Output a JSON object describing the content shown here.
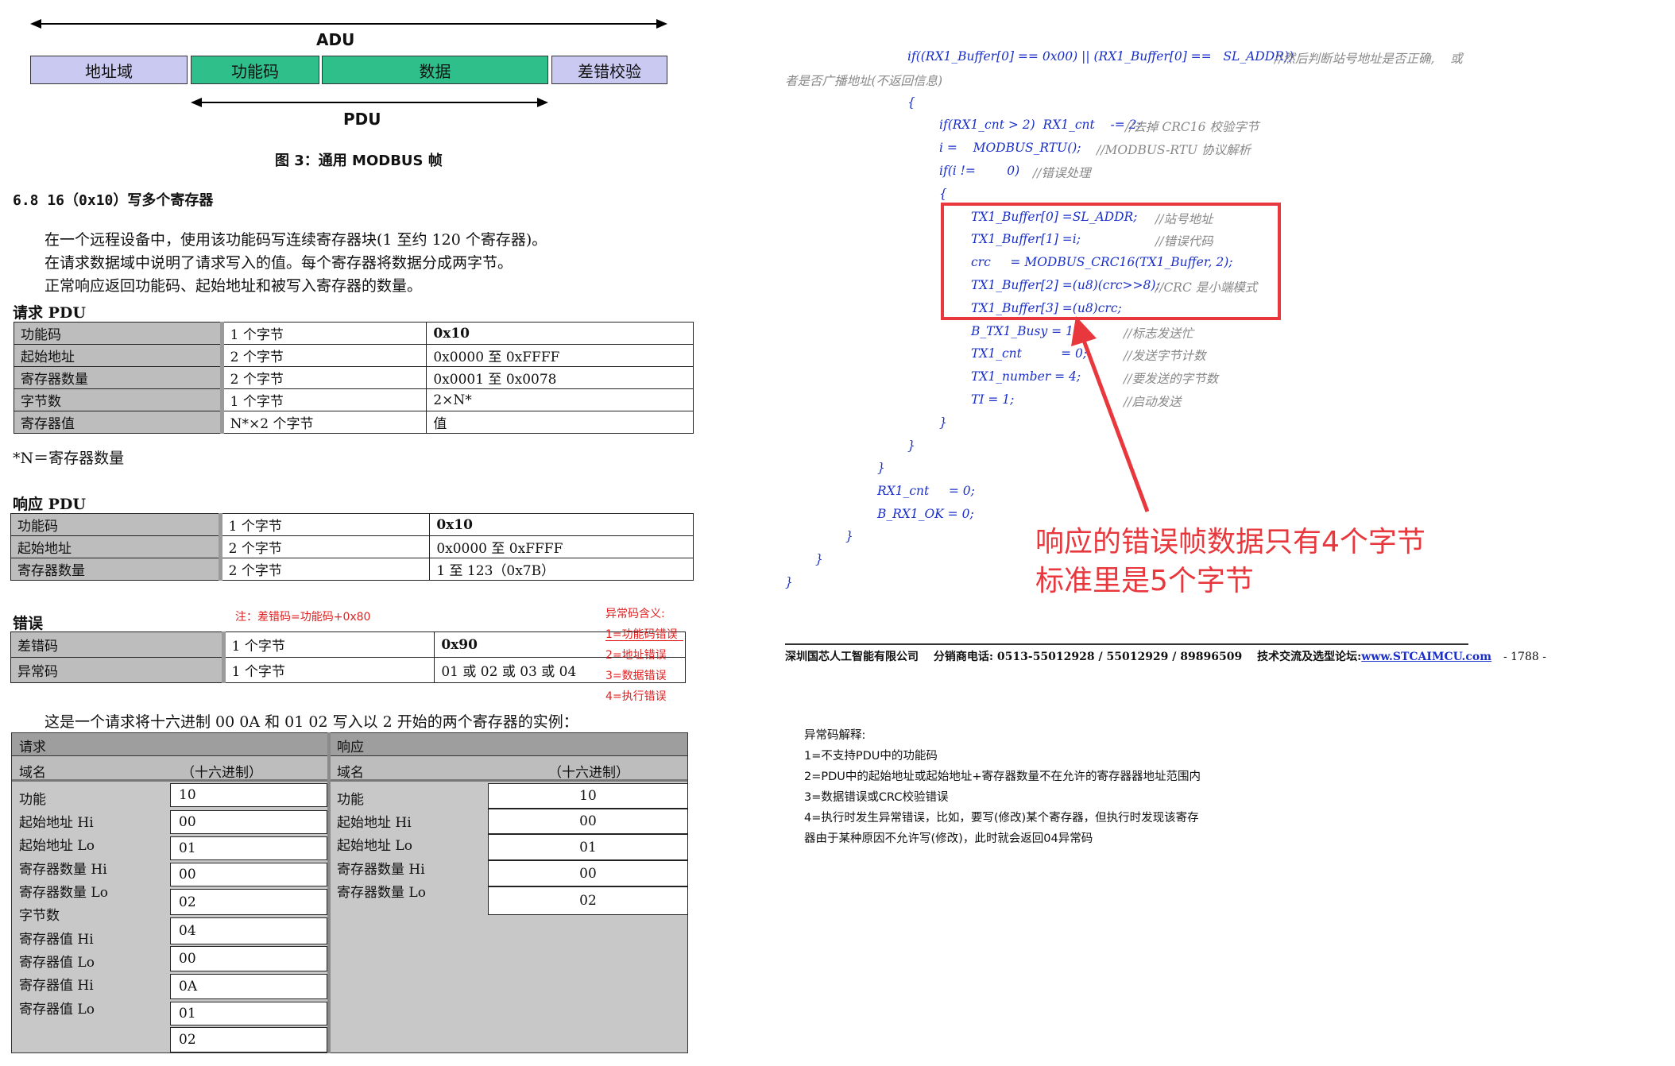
{
  "diagram": {
    "adu_label": "ADU",
    "pdu_label": "PDU",
    "boxes": [
      "地址域",
      "功能码",
      "数据",
      "差错校验"
    ],
    "caption": "图 3：通用 MODBUS 帧"
  },
  "section": {
    "title": "6.8   16（0x10）写多个寄存器",
    "para1": "在一个远程设备中，使用该功能码写连续寄存器块(1 至约 120 个寄存器)。",
    "para2": "在请求数据域中说明了请求写入的值。每个寄存器将数据分成两字节。",
    "para3": "正常响应返回功能码、起始地址和被写入寄存器的数量。"
  },
  "request_pdu": {
    "title": "请求 PDU",
    "rows": [
      [
        "功能码",
        "1 个字节",
        "0x10"
      ],
      [
        "起始地址",
        "2 个字节",
        "0x0000 至 0xFFFF"
      ],
      [
        "寄存器数量",
        "2 个字节",
        "0x0001 至 0x0078"
      ],
      [
        "字节数",
        "1 个字节",
        "2×N*"
      ],
      [
        "寄存器值",
        "N*×2 个字节",
        "值"
      ]
    ],
    "footnote": "*N＝寄存器数量"
  },
  "response_pdu": {
    "title": "响应 PDU",
    "rows": [
      [
        "功能码",
        "1 个字节",
        "0x10"
      ],
      [
        "起始地址",
        "2 个字节",
        "0x0000 至 0xFFFF"
      ],
      [
        "寄存器数量",
        "2 个字节",
        "1 至 123（0x7B）"
      ]
    ]
  },
  "error_pdu": {
    "title": "错误",
    "note": "注：差错码=功能码+0x80",
    "rows": [
      [
        "差错码",
        "1 个字节",
        "0x90"
      ],
      [
        "异常码",
        "1 个字节",
        "01 或 02 或 03 或 04"
      ]
    ],
    "exception_title": "异常码含义:",
    "exception_items": [
      "1=功能码错误",
      "2=地址错误",
      "3=数据错误",
      "4=执行错误"
    ]
  },
  "example": {
    "intro": "这是一个请求将十六进制 00 0A 和 01 02 写入以 2 开始的两个寄存器的实例：",
    "req_header": "请求",
    "resp_header": "响应",
    "field_label": "域名",
    "hex_label": "（十六进制）",
    "req_fields": [
      "功能",
      "起始地址 Hi",
      "起始地址 Lo",
      "寄存器数量 Hi",
      "寄存器数量 Lo",
      "字节数",
      "寄存器值 Hi",
      "寄存器值 Lo",
      "寄存器值 Hi",
      "寄存器值 Lo"
    ],
    "req_values": [
      "10",
      "00",
      "01",
      "00",
      "02",
      "04",
      "00",
      "0A",
      "01",
      "02"
    ],
    "resp_fields": [
      "功能",
      "起始地址 Hi",
      "起始地址 Lo",
      "寄存器数量 Hi",
      "寄存器数量 Lo"
    ],
    "resp_values": [
      "10",
      "00",
      "01",
      "00",
      "02"
    ]
  },
  "code": {
    "lines": [
      "if((RX1_Buffer[0] == 0x00) || (RX1_Buffer[0] ==   SL_ADDR))",
      "{",
      "if(RX1_cnt > 2)  RX1_cnt    -= 2;",
      "i =    MODBUS_RTU();",
      "if(i !=        0)",
      "{",
      "TX1_Buffer[0] =SL_ADDR;",
      "TX1_Buffer[1] =i;",
      "crc     = MODBUS_CRC16(TX1_Buffer, 2);",
      "TX1_Buffer[2] =(u8)(crc>>8);",
      "TX1_Buffer[3] =(u8)crc;",
      "B_TX1_Busy = 1;",
      "TX1_cnt          = 0;",
      "TX1_number = 4;",
      "TI = 1;",
      "}",
      "}",
      "}",
      "RX1_cnt     = 0;",
      "B_RX1_OK = 0;",
      "}",
      "}",
      "}"
    ],
    "comments": [
      "//然后判断站号地址是否正确,    或",
      "者是否广播地址(不返回信息)",
      "//去掉 CRC16 校验字节",
      "//MODBUS-RTU 协议解析",
      "//错误处理",
      "//站号地址",
      "//错误代码",
      "//CRC 是小端模式",
      "//标志发送忙",
      "//发送字节计数",
      "//要发送的字节数",
      "//启动发送"
    ]
  },
  "annotation": {
    "line1": "响应的错误帧数据只有4个字节",
    "line2": "标准里是5个字节",
    "color": "#e8383d"
  },
  "footer": {
    "company": "深圳国芯人工智能有限公司",
    "phone": "分销商电话: 0513-55012928 / 55012929 / 89896509",
    "forum_prefix": "技术交流及选型论坛:",
    "forum_link": "www.STCAIMCU.com",
    "page": "- 1788 -"
  },
  "explanation": {
    "title": "异常码解释:",
    "items": [
      "1=不支持PDU中的功能码",
      "2=PDU中的起始地址或起始地址+寄存器数量不在允许的寄存器器地址范围内",
      "3=数据错误或CRC校验错误",
      "4=执行时发生异常错误，比如，要写(修改)某个寄存器，但执行时发现该寄存",
      "器由于某种原因不允许写(修改)，此时就会返回04异常码"
    ]
  }
}
